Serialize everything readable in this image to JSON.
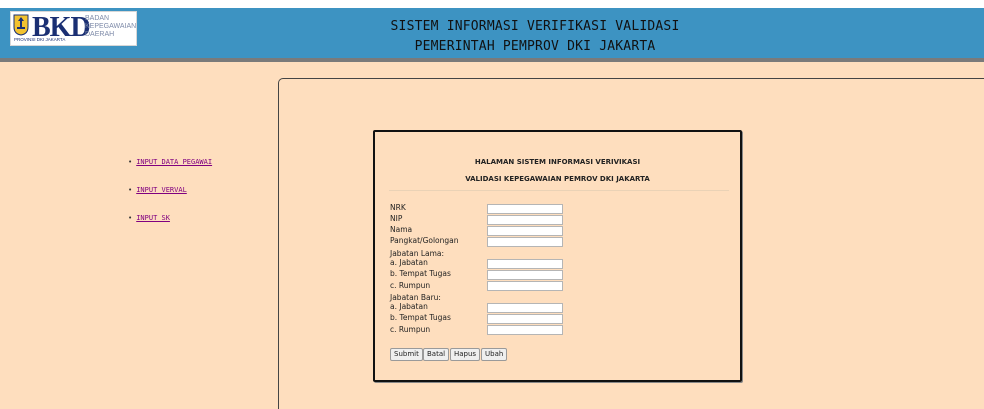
{
  "header": {
    "logo": {
      "brand": "BKD",
      "sub_lines": [
        "BADAN",
        "KEPEGAWAIAN",
        "DAERAH"
      ],
      "province": "PROVINSI DKI JAKARTA"
    },
    "title_line1": "SISTEM INFORMASI VERIFIKASI VALIDASI",
    "title_line2": "PEMERINTAH PEMPROV DKI JAKARTA"
  },
  "colors": {
    "header_bg": "#3d93c2",
    "page_bg": "#fedebe",
    "link": "#800080"
  },
  "sidebar": {
    "items": [
      {
        "label": "INPUT DATA PEGAWAI"
      },
      {
        "label": "INPUT VERVAL"
      },
      {
        "label": "INPUT SK"
      }
    ]
  },
  "form": {
    "title_line1": "HALAMAN SISTEM INFORMASI VERIVIKASI",
    "title_line2": "VALIDASI KEPEGAWAIAN PEMROV DKI JAKARTA",
    "labels": {
      "nrk": "NRK",
      "nip": "NIP",
      "nama": "Nama",
      "pangkat": "Pangkat/Golongan",
      "jabatan_lama": "Jabatan Lama:",
      "lama_jabatan": "a. Jabatan",
      "lama_tempat": "b. Tempat Tugas",
      "lama_rumpun": "c. Rumpun",
      "jabatan_baru": "Jabatan Baru:",
      "baru_jabatan": "a. Jabatan",
      "baru_tempat": "b. Tempat Tugas",
      "baru_rumpun": "c. Rumpun"
    },
    "values": {
      "nrk": "",
      "nip": "",
      "nama": "",
      "pangkat": "",
      "lama_jabatan": "",
      "lama_tempat": "",
      "lama_rumpun": "",
      "baru_jabatan": "",
      "baru_tempat": "",
      "baru_rumpun": ""
    },
    "buttons": {
      "submit": "Submit",
      "batal": "Batal",
      "hapus": "Hapus",
      "ubah": "Ubah"
    }
  }
}
